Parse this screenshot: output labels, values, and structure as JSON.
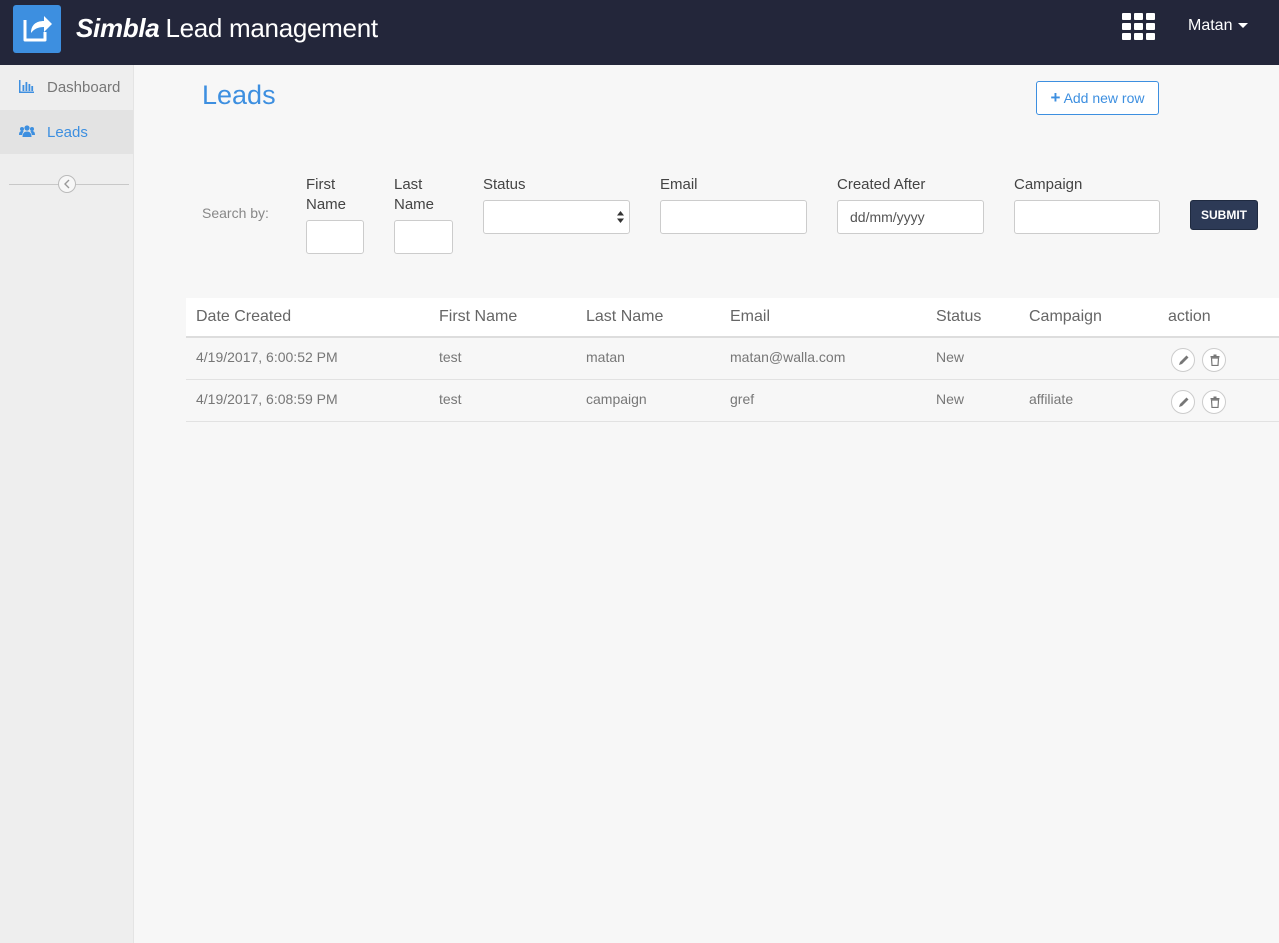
{
  "header": {
    "brand_bold": "Simbla",
    "brand_title": "Lead management",
    "user_name": "Matan"
  },
  "sidebar": {
    "items": [
      {
        "label": "Dashboard",
        "icon": "bar-chart-icon",
        "active": false
      },
      {
        "label": "Leads",
        "icon": "users-icon",
        "active": true
      }
    ]
  },
  "main": {
    "title": "Leads",
    "add_button_label": "Add new row"
  },
  "search": {
    "label": "Search by:",
    "first_name_label": "First Name",
    "last_name_label": "Last Name",
    "status_label": "Status",
    "status_value": "",
    "email_label": "Email",
    "email_value": "",
    "created_after_label": "Created After",
    "created_after_placeholder": "dd/mm/yyyy",
    "campaign_label": "Campaign",
    "campaign_value": "",
    "submit_label": "SUBMIT"
  },
  "table": {
    "columns": [
      "Date Created",
      "First Name",
      "Last Name",
      "Email",
      "Status",
      "Campaign",
      "action"
    ],
    "rows": [
      {
        "date_created": "4/19/2017, 6:00:52 PM",
        "first_name": "test",
        "last_name": "matan",
        "email": "matan@walla.com",
        "status": "New",
        "campaign": ""
      },
      {
        "date_created": "4/19/2017, 6:08:59 PM",
        "first_name": "test",
        "last_name": "campaign",
        "email": "gref",
        "status": "New",
        "campaign": "affiliate"
      }
    ]
  },
  "colors": {
    "accent": "#3d8fe0",
    "topbar": "#23263a",
    "submit": "#2d3a56",
    "page_background": "#f7f7f7",
    "sidebar_background": "#eeeeee"
  }
}
